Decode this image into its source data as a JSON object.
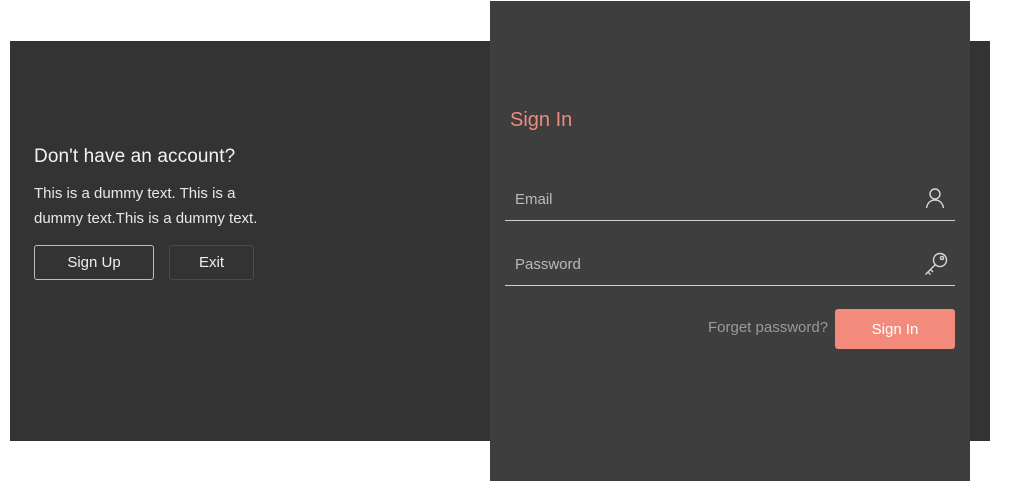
{
  "intro": {
    "title": "Don't have an account?",
    "text_line1": "This is a dummy text. This is a",
    "text_line2": "dummy text.This is a dummy text.",
    "signup_label": "Sign Up",
    "exit_label": "Exit"
  },
  "signin": {
    "title": "Sign In",
    "email_placeholder": "Email",
    "password_placeholder": "Password",
    "forget_label": "Forget password?",
    "button_label": "Sign In"
  },
  "icons": {
    "email": "user-icon",
    "password": "key-icon"
  },
  "colors": {
    "accent": "#f28b7b",
    "exit_border": "#9a2a2a",
    "back_panel": "#333333",
    "front_panel": "#3e3e3e"
  }
}
